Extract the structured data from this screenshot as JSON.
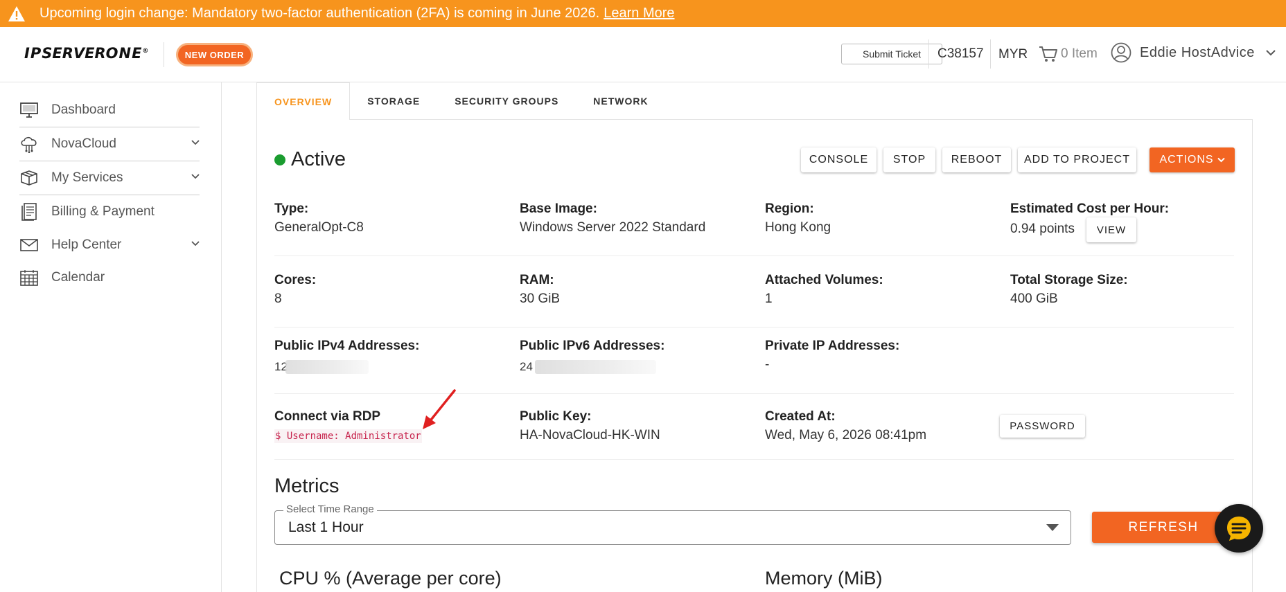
{
  "banner": {
    "message": "Upcoming login change: Mandatory two-factor authentication (2FA) is coming in June 2026.",
    "link": "Learn More"
  },
  "header": {
    "logo_text": "IPSERVERONE",
    "new_order": "NEW ORDER",
    "submit_ticket": "Submit Ticket",
    "account_id": "C38157",
    "currency": "MYR",
    "cart": "0 Item",
    "user_name": "Eddie HostAdvice"
  },
  "sidebar": {
    "items": [
      {
        "label": "Dashboard",
        "icon": "monitor-icon"
      },
      {
        "label": "NovaCloud",
        "icon": "cloud-icon"
      },
      {
        "label": "My Services",
        "icon": "box-icon"
      },
      {
        "label": "Billing & Payment",
        "icon": "invoice-icon"
      },
      {
        "label": "Help Center",
        "icon": "mail-icon"
      },
      {
        "label": "Calendar",
        "icon": "calendar-icon"
      }
    ]
  },
  "tabs": [
    "OVERVIEW",
    "STORAGE",
    "SECURITY GROUPS",
    "NETWORK"
  ],
  "instance": {
    "status": "Active",
    "buttons": {
      "console": "CONSOLE",
      "stop": "STOP",
      "reboot": "REBOOT",
      "add_to_project": "ADD TO PROJECT",
      "actions": "ACTIONS"
    },
    "details": {
      "type_label": "Type:",
      "type_value": "GeneralOpt-C8",
      "image_label": "Base Image:",
      "image_value": "Windows Server 2022 Standard",
      "region_label": "Region:",
      "region_value": "Hong Kong",
      "cost_label": "Estimated Cost per Hour:",
      "cost_value": "0.94 points",
      "view": "VIEW",
      "cores_label": "Cores:",
      "cores_value": "8",
      "ram_label": "RAM:",
      "ram_value": "30 GiB",
      "volumes_label": "Attached Volumes:",
      "volumes_value": "1",
      "storage_label": "Total Storage Size:",
      "storage_value": "400 GiB",
      "ipv4_label": "Public IPv4 Addresses:",
      "ipv4_value": "12",
      "ipv6_label": "Public IPv6 Addresses:",
      "ipv6_value": "24",
      "private_label": "Private IP Addresses:",
      "private_value": "-",
      "rdp_label": "Connect via RDP",
      "rdp_value": "$ Username: Administrator",
      "key_label": "Public Key:",
      "key_value": "HA-NovaCloud-HK-WIN",
      "created_label": "Created At:",
      "created_value": "Wed, May 6, 2026 08:41pm",
      "password": "PASSWORD"
    }
  },
  "metrics": {
    "title": "Metrics",
    "range_legend": "Select Time Range",
    "range_value": "Last 1 Hour",
    "refresh": "REFRESH",
    "cpu_title": "CPU % (Average per core)",
    "memory_title": "Memory (MiB)"
  },
  "colors": {
    "brand_orange": "#f26522",
    "banner_orange": "#f7941d",
    "active_green": "#1a9c2f",
    "annotation_red": "#e02020"
  }
}
